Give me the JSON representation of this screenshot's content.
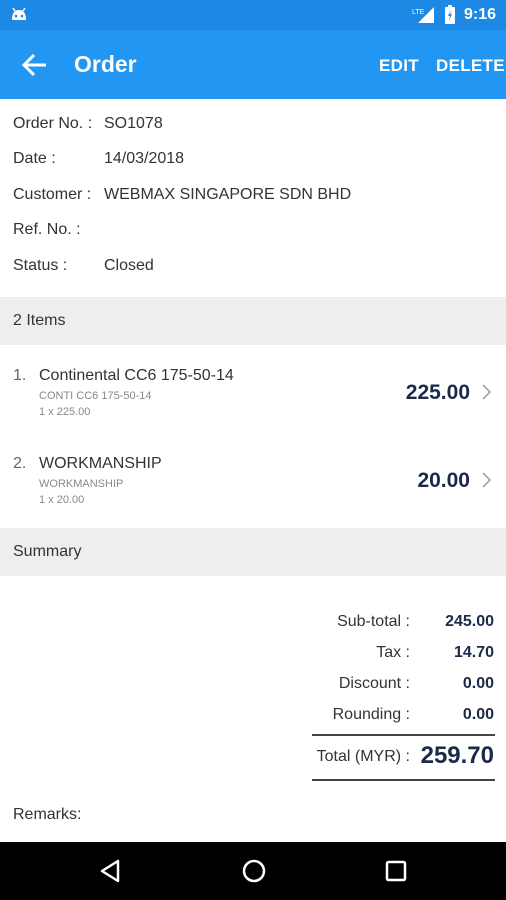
{
  "status_bar": {
    "time": "9:16",
    "network_label": "LTE",
    "icons": [
      "android-icon",
      "lte-signal-icon",
      "battery-icon"
    ]
  },
  "app_bar": {
    "title": "Order",
    "edit_label": "EDIT",
    "delete_label": "DELETE",
    "color": "#2196f3"
  },
  "order": {
    "order_no_label": "Order No. :",
    "order_no": "SO1078",
    "date_label": "Date :",
    "date": "14/03/2018",
    "customer_label": "Customer :",
    "customer": "WEBMAX SINGAPORE SDN BHD",
    "ref_label": "Ref. No. :",
    "ref": "",
    "status_label": "Status :",
    "status": "Closed"
  },
  "items_header": "2 Items",
  "items": [
    {
      "index": "1.",
      "name": "Continental CC6 175-50-14",
      "code": "CONTI CC6 175-50-14",
      "qty": "1 x 225.00",
      "amount": "225.00"
    },
    {
      "index": "2.",
      "name": "WORKMANSHIP",
      "code": "WORKMANSHIP",
      "qty": "1 x 20.00",
      "amount": "20.00"
    }
  ],
  "summary_header": "Summary",
  "summary": {
    "subtotal_label": "Sub-total :",
    "subtotal": "245.00",
    "tax_label": "Tax :",
    "tax": "14.70",
    "discount_label": "Discount :",
    "discount": "0.00",
    "rounding_label": "Rounding :",
    "rounding": "0.00",
    "total_label": "Total (MYR) :",
    "total": "259.70"
  },
  "remarks_label": "Remarks:",
  "nav": {
    "icons": [
      "back-triangle-icon",
      "home-circle-icon",
      "recents-square-icon"
    ]
  }
}
